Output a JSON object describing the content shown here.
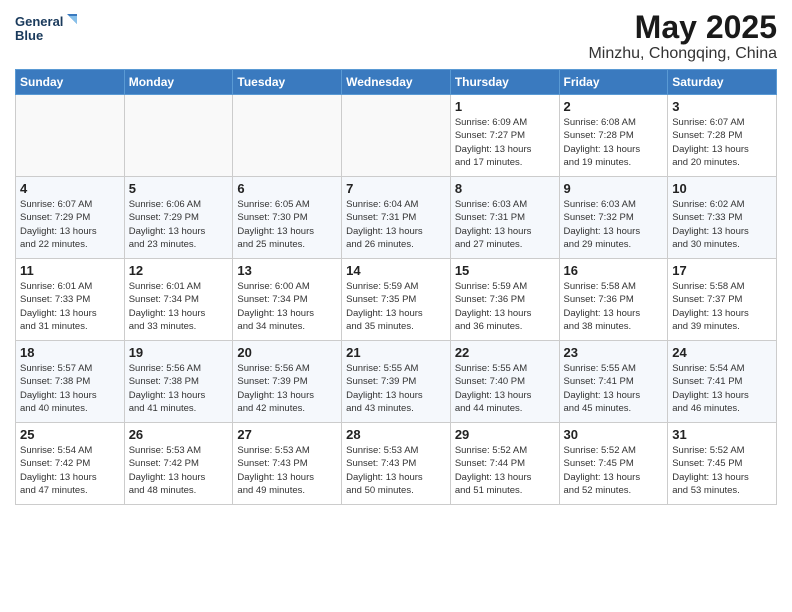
{
  "logo": {
    "line1": "General",
    "line2": "Blue"
  },
  "title": "May 2025",
  "subtitle": "Minzhu, Chongqing, China",
  "weekdays": [
    "Sunday",
    "Monday",
    "Tuesday",
    "Wednesday",
    "Thursday",
    "Friday",
    "Saturday"
  ],
  "weeks": [
    [
      {
        "day": "",
        "info": ""
      },
      {
        "day": "",
        "info": ""
      },
      {
        "day": "",
        "info": ""
      },
      {
        "day": "",
        "info": ""
      },
      {
        "day": "1",
        "info": "Sunrise: 6:09 AM\nSunset: 7:27 PM\nDaylight: 13 hours\nand 17 minutes."
      },
      {
        "day": "2",
        "info": "Sunrise: 6:08 AM\nSunset: 7:28 PM\nDaylight: 13 hours\nand 19 minutes."
      },
      {
        "day": "3",
        "info": "Sunrise: 6:07 AM\nSunset: 7:28 PM\nDaylight: 13 hours\nand 20 minutes."
      }
    ],
    [
      {
        "day": "4",
        "info": "Sunrise: 6:07 AM\nSunset: 7:29 PM\nDaylight: 13 hours\nand 22 minutes."
      },
      {
        "day": "5",
        "info": "Sunrise: 6:06 AM\nSunset: 7:29 PM\nDaylight: 13 hours\nand 23 minutes."
      },
      {
        "day": "6",
        "info": "Sunrise: 6:05 AM\nSunset: 7:30 PM\nDaylight: 13 hours\nand 25 minutes."
      },
      {
        "day": "7",
        "info": "Sunrise: 6:04 AM\nSunset: 7:31 PM\nDaylight: 13 hours\nand 26 minutes."
      },
      {
        "day": "8",
        "info": "Sunrise: 6:03 AM\nSunset: 7:31 PM\nDaylight: 13 hours\nand 27 minutes."
      },
      {
        "day": "9",
        "info": "Sunrise: 6:03 AM\nSunset: 7:32 PM\nDaylight: 13 hours\nand 29 minutes."
      },
      {
        "day": "10",
        "info": "Sunrise: 6:02 AM\nSunset: 7:33 PM\nDaylight: 13 hours\nand 30 minutes."
      }
    ],
    [
      {
        "day": "11",
        "info": "Sunrise: 6:01 AM\nSunset: 7:33 PM\nDaylight: 13 hours\nand 31 minutes."
      },
      {
        "day": "12",
        "info": "Sunrise: 6:01 AM\nSunset: 7:34 PM\nDaylight: 13 hours\nand 33 minutes."
      },
      {
        "day": "13",
        "info": "Sunrise: 6:00 AM\nSunset: 7:34 PM\nDaylight: 13 hours\nand 34 minutes."
      },
      {
        "day": "14",
        "info": "Sunrise: 5:59 AM\nSunset: 7:35 PM\nDaylight: 13 hours\nand 35 minutes."
      },
      {
        "day": "15",
        "info": "Sunrise: 5:59 AM\nSunset: 7:36 PM\nDaylight: 13 hours\nand 36 minutes."
      },
      {
        "day": "16",
        "info": "Sunrise: 5:58 AM\nSunset: 7:36 PM\nDaylight: 13 hours\nand 38 minutes."
      },
      {
        "day": "17",
        "info": "Sunrise: 5:58 AM\nSunset: 7:37 PM\nDaylight: 13 hours\nand 39 minutes."
      }
    ],
    [
      {
        "day": "18",
        "info": "Sunrise: 5:57 AM\nSunset: 7:38 PM\nDaylight: 13 hours\nand 40 minutes."
      },
      {
        "day": "19",
        "info": "Sunrise: 5:56 AM\nSunset: 7:38 PM\nDaylight: 13 hours\nand 41 minutes."
      },
      {
        "day": "20",
        "info": "Sunrise: 5:56 AM\nSunset: 7:39 PM\nDaylight: 13 hours\nand 42 minutes."
      },
      {
        "day": "21",
        "info": "Sunrise: 5:55 AM\nSunset: 7:39 PM\nDaylight: 13 hours\nand 43 minutes."
      },
      {
        "day": "22",
        "info": "Sunrise: 5:55 AM\nSunset: 7:40 PM\nDaylight: 13 hours\nand 44 minutes."
      },
      {
        "day": "23",
        "info": "Sunrise: 5:55 AM\nSunset: 7:41 PM\nDaylight: 13 hours\nand 45 minutes."
      },
      {
        "day": "24",
        "info": "Sunrise: 5:54 AM\nSunset: 7:41 PM\nDaylight: 13 hours\nand 46 minutes."
      }
    ],
    [
      {
        "day": "25",
        "info": "Sunrise: 5:54 AM\nSunset: 7:42 PM\nDaylight: 13 hours\nand 47 minutes."
      },
      {
        "day": "26",
        "info": "Sunrise: 5:53 AM\nSunset: 7:42 PM\nDaylight: 13 hours\nand 48 minutes."
      },
      {
        "day": "27",
        "info": "Sunrise: 5:53 AM\nSunset: 7:43 PM\nDaylight: 13 hours\nand 49 minutes."
      },
      {
        "day": "28",
        "info": "Sunrise: 5:53 AM\nSunset: 7:43 PM\nDaylight: 13 hours\nand 50 minutes."
      },
      {
        "day": "29",
        "info": "Sunrise: 5:52 AM\nSunset: 7:44 PM\nDaylight: 13 hours\nand 51 minutes."
      },
      {
        "day": "30",
        "info": "Sunrise: 5:52 AM\nSunset: 7:45 PM\nDaylight: 13 hours\nand 52 minutes."
      },
      {
        "day": "31",
        "info": "Sunrise: 5:52 AM\nSunset: 7:45 PM\nDaylight: 13 hours\nand 53 minutes."
      }
    ]
  ]
}
